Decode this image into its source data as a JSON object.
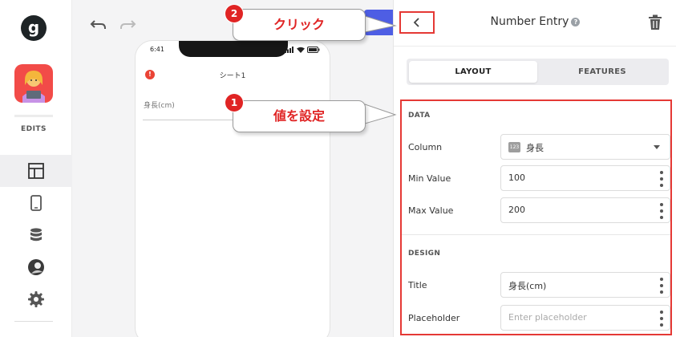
{
  "sidebar": {
    "logo": "g",
    "edits_label": "EDITS",
    "nav": [
      "layout-icon",
      "mobile-icon",
      "database-icon",
      "avatar-icon",
      "gear-icon"
    ]
  },
  "canvas": {
    "phone": {
      "time": "6:41",
      "title": "シート1",
      "field_label": "身長(cm)"
    }
  },
  "callouts": [
    {
      "number": "1",
      "text": "値を設定"
    },
    {
      "number": "2",
      "text": "クリック"
    }
  ],
  "panel": {
    "title": "Number Entry",
    "help": "?",
    "tabs": [
      "LAYOUT",
      "FEATURES"
    ],
    "data_section": {
      "heading": "DATA",
      "column_label": "Column",
      "column_type_badge": "123",
      "column_value": "身長",
      "min_label": "Min Value",
      "min_value": "100",
      "max_label": "Max Value",
      "max_value": "200"
    },
    "design_section": {
      "heading": "DESIGN",
      "title_label": "Title",
      "title_value": "身長(cm)",
      "placeholder_label": "Placeholder",
      "placeholder_value": "Enter placeholder"
    }
  },
  "colors": {
    "accent": "#4e5ee4",
    "highlight_red": "#e53935",
    "app_icon_bg": "#f24b48"
  }
}
